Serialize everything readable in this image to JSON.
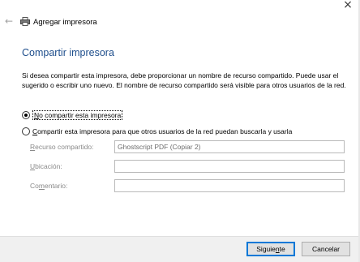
{
  "window": {
    "title": "Agregar impresora",
    "close_glyph": "×",
    "back_glyph": "←",
    "back_icon": "back-arrow-icon",
    "printer_icon": "printer-icon"
  },
  "main": {
    "heading": "Compartir impresora",
    "intro": "Si desea compartir esta impresora, debe proporcionar un nombre de recurso compartido. Puede usar el sugerido o escribir uno nuevo. El nombre de recurso compartido será visible para otros usuarios de la red."
  },
  "options": {
    "no_share": {
      "pre": "",
      "mnemonic": "N",
      "post": "o compartir esta impresora",
      "checked": true
    },
    "share": {
      "pre": "",
      "mnemonic": "C",
      "post": "ompartir esta impresora para que otros usuarios de la red puedan buscarla y usarla",
      "checked": false
    }
  },
  "fields": {
    "share_name": {
      "label_pre": "",
      "label_mn": "R",
      "label_post": "ecurso compartido:",
      "value": "Ghostscript PDF (Copiar 2)"
    },
    "location": {
      "label_pre": "",
      "label_mn": "U",
      "label_post": "bicación:",
      "value": ""
    },
    "comment": {
      "label_pre": "Co",
      "label_mn": "m",
      "label_post": "entario:",
      "value": ""
    }
  },
  "buttons": {
    "next": {
      "pre": "Siguie",
      "mnemonic": "n",
      "post": "te"
    },
    "cancel": "Cancelar"
  },
  "colors": {
    "heading": "#1e4e8c",
    "primary_border": "#0078d7"
  }
}
